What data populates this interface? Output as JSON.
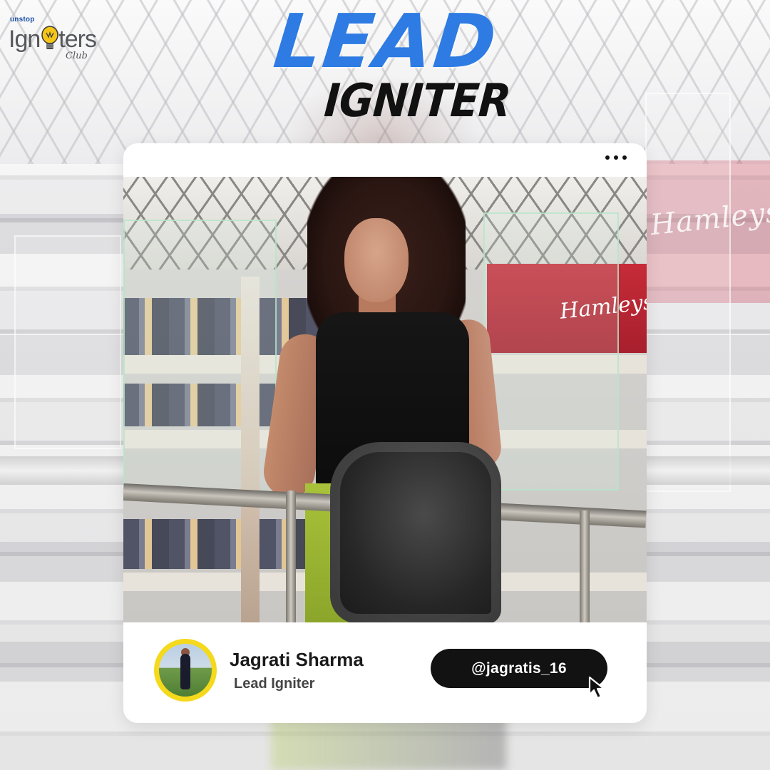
{
  "logo": {
    "brand_small": "unstop",
    "wordmark_pre": "Ign",
    "wordmark_post": "ters",
    "club": "Club"
  },
  "headline": {
    "line1": "LEAD",
    "line2": "IGNITER"
  },
  "card": {
    "menu_icon": "more-horizontal-icon",
    "background_shop_sign": "Hamleys",
    "photo_shop_sign": "Hamleys",
    "profile": {
      "name": "Jagrati Sharma",
      "role": "Lead Igniter",
      "handle": "@jagratis_16"
    },
    "cursor_icon": "mouse-pointer-icon"
  },
  "colors": {
    "accent_blue": "#2d7be3",
    "avatar_ring": "#f4d91c",
    "pill_bg": "#121212",
    "text_dark": "#1a1a1a"
  }
}
